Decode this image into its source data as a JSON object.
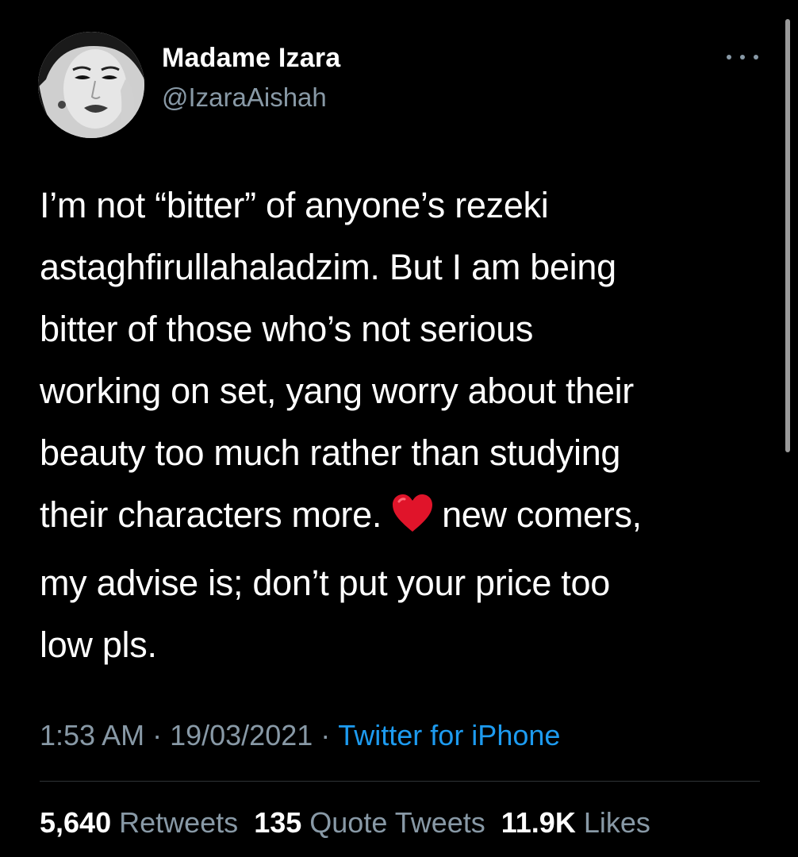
{
  "author": {
    "display_name": "Madame Izara",
    "handle": "@IzaraAishah"
  },
  "tweet": {
    "lines": [
      "I’m not “bitter” of anyone’s rezeki",
      "astaghfirullahaladzim. But I am being",
      "bitter of those who’s not serious",
      "working on set, yang worry about their",
      "beauty too much rather than studying",
      "their characters more.",
      "new comers,",
      "my advise is; don’t put your price too",
      "low pls."
    ],
    "emoji": "red-heart"
  },
  "meta": {
    "time": "1:53 AM",
    "separator": "·",
    "date": "19/03/2021",
    "source": "Twitter for iPhone"
  },
  "stats": {
    "retweets_count": "5,640",
    "retweets_label": "Retweets",
    "quotes_count": "135",
    "quotes_label": "Quote Tweets",
    "likes_count": "11.9K",
    "likes_label": "Likes"
  },
  "colors": {
    "background": "#000000",
    "text": "#ffffff",
    "secondary": "#8899a6",
    "link": "#1d9bf0",
    "heart": "#e0142a"
  }
}
